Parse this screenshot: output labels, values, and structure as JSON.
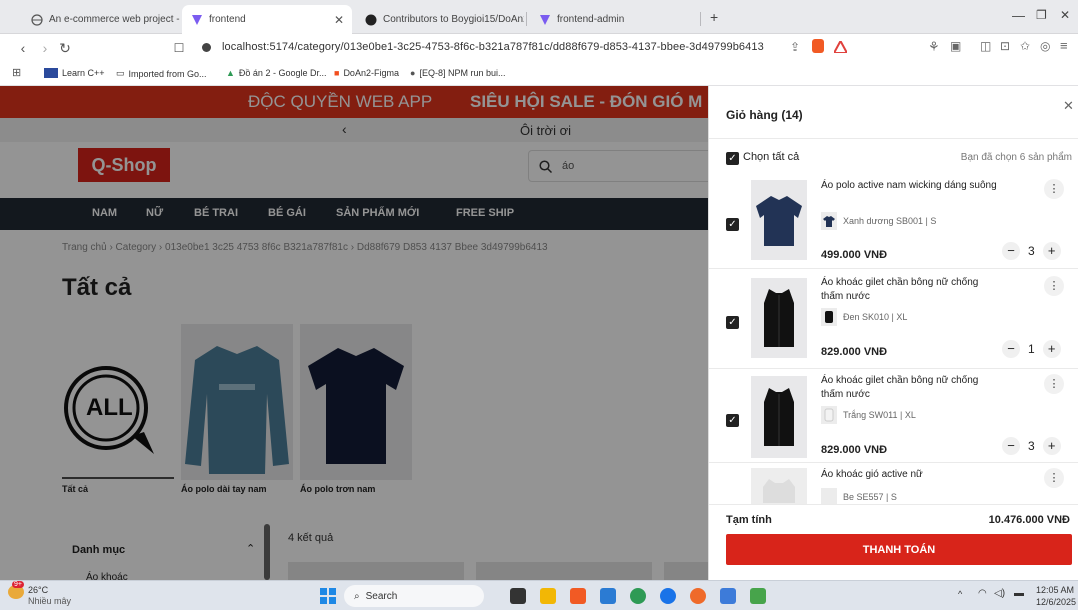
{
  "browser": {
    "tabs": [
      {
        "label": "An e-commerce web project - Cart"
      },
      {
        "label": "frontend"
      },
      {
        "label": "Contributors to Boygioi15/DoAn2"
      },
      {
        "label": "frontend-admin"
      }
    ],
    "new_tab": "+",
    "url": "localhost:5174/category/013e0be1-3c25-4753-8f6c-b321a787f81c/dd88f679-d853-4137-bbee-3d49799b6413",
    "bookmarks": [
      "Learn C++",
      "Imported from Go...",
      "Đồ án 2 - Google Dr...",
      "DoAn2-Figma",
      "[EQ-8] NPM run bui..."
    ]
  },
  "site": {
    "promo": "ĐỘC QUYỀN WEB APP",
    "promo_bold": "SIÊU HỘI SALE - ĐÓN GIÓ M",
    "sub_promo": "Ôi trời ơi",
    "logo": "Q-Shop",
    "search_value": "áo",
    "menu": [
      "NAM",
      "NỮ",
      "BÉ TRAI",
      "BÉ GÁI",
      "SẢN PHẨM MỚI",
      "FREE SHIP"
    ],
    "breadcrumb": [
      "Trang chủ",
      "Category",
      "013e0be1 3c25 4753 8f6c B321a787f81c",
      "Dd88f679 D853 4137 Bbee 3d49799b6413"
    ],
    "page_title": "Tất cả",
    "categories": [
      {
        "label": "Tất cả",
        "badge": "ALL"
      },
      {
        "label": "Áo polo dài tay nam"
      },
      {
        "label": "Áo polo trơn nam"
      }
    ],
    "filter_title": "Danh mục",
    "filter_item": "Áo khoác",
    "results": "4 kết quả"
  },
  "cart": {
    "title": "Giỏ hàng (14)",
    "select_all": "Chọn tất cả",
    "selected_count": "Bạn đã chọn 6 sản phẩm",
    "items": [
      {
        "name": "Áo polo active nam wicking dáng suông",
        "variant": "Xanh dương SB001 | S",
        "price": "499.000 VNĐ",
        "qty": "3",
        "checked": true
      },
      {
        "name": "Áo khoác gilet chần bông nữ chống thấm nước",
        "variant": "Đen SK010 | XL",
        "price": "829.000 VNĐ",
        "qty": "1",
        "checked": true
      },
      {
        "name": "Áo khoác gilet chần bông nữ chống thấm nước",
        "variant": "Trắng SW011 | XL",
        "price": "829.000 VNĐ",
        "qty": "3",
        "checked": true
      },
      {
        "name": "Áo khoác gió active nữ",
        "variant": "Be SE557 | S",
        "price": "",
        "qty": "",
        "checked": false
      }
    ],
    "subtotal_label": "Tạm tính",
    "subtotal_value": "10.476.000 VNĐ",
    "checkout": "THANH TOÁN"
  },
  "taskbar": {
    "weather_temp": "26°C",
    "weather_text": "Nhiều mây",
    "weather_badge": "9+",
    "search": "Search",
    "time": "12:05 AM",
    "date": "12/6/2025"
  },
  "colors": {
    "accent": "#d8241a",
    "menu_bg": "#212a35"
  }
}
